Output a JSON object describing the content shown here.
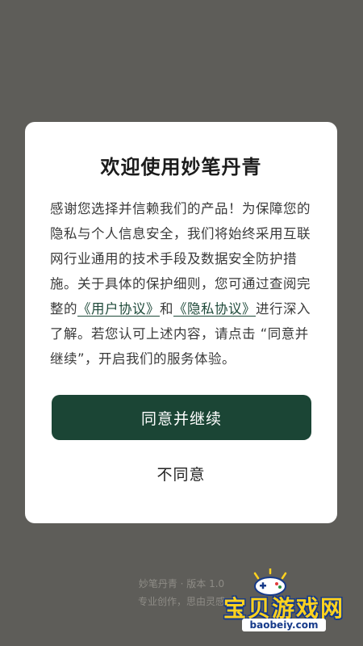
{
  "dialog": {
    "title": "欢迎使用妙笔丹青",
    "body_part1": "感谢您选择并信赖我们的产品！为保障您的隐私与个人信息安全，我们将始终采用互联网行业通用的技术手段及数据安全防护措施。关于具体的保护细则，您可通过查阅完整的",
    "link_user_agreement": "《用户协议》",
    "body_and": "和",
    "link_privacy_agreement": "《隐私协议》",
    "body_part2": "进行深入了解。若您认可上述内容，请点击 “同意并继续”，开启我们的服务体验。",
    "agree_label": "同意并继续",
    "disagree_label": "不同意"
  },
  "footer": {
    "line1": "妙笔丹青 · 版本 1.0",
    "line2": "专业创作，思由灵感"
  },
  "watermark": {
    "title": "宝贝游戏网",
    "url": "baobeiy.com",
    "icon": "gamepad-icon"
  },
  "colors": {
    "backdrop": "#5e5d59",
    "dialog_bg": "#ffffff",
    "primary_button": "#1b4535",
    "link": "#1f4a3a"
  }
}
